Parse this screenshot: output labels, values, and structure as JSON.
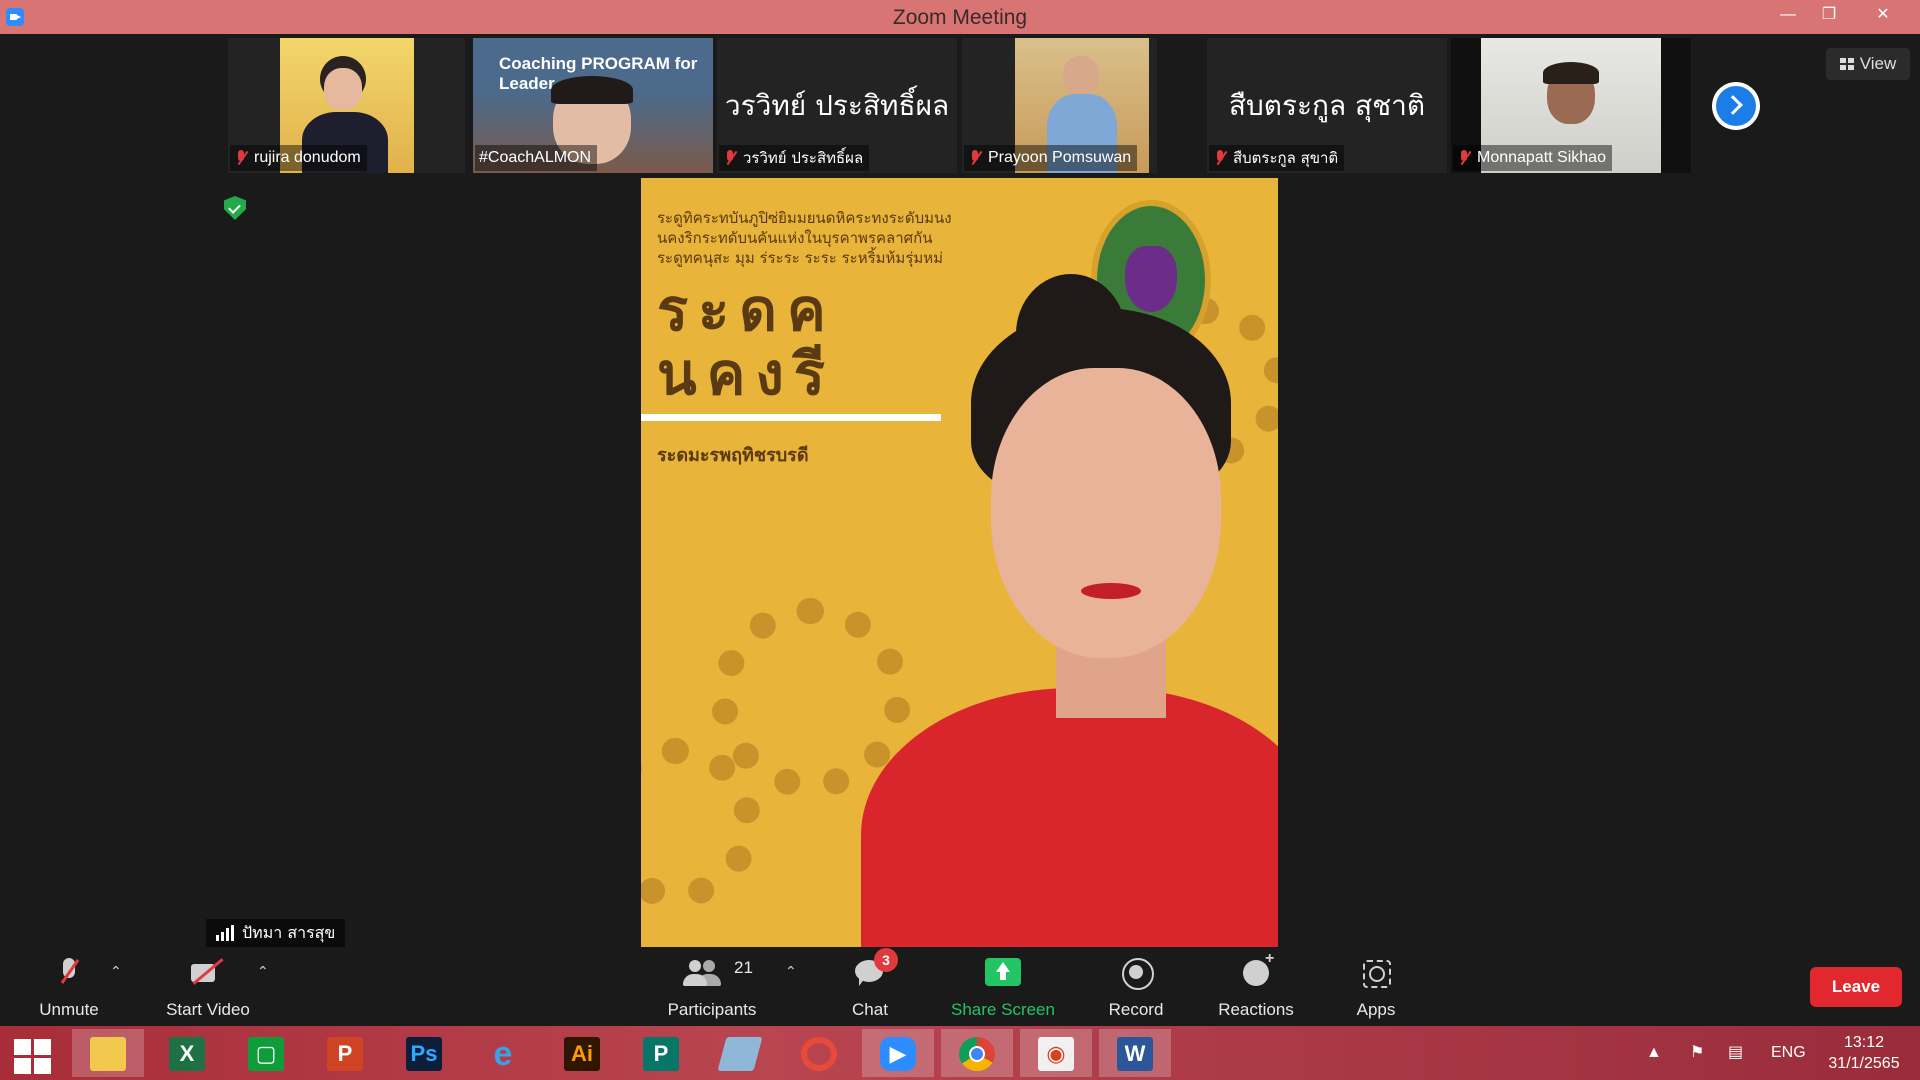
{
  "window": {
    "title": "Zoom Meeting"
  },
  "gallery": {
    "tiles": [
      {
        "name": "rujira donudom",
        "muted": true
      },
      {
        "name": "#CoachALMON",
        "muted": false,
        "video_text": "Coaching PROGRAM for Leader"
      },
      {
        "name": "วรวิทย์ ประสิทธิ์ผล",
        "muted": true,
        "big_name": "วรวิทย์ ประสิทธิ์ผล"
      },
      {
        "name": "Prayoon Pomsuwan",
        "muted": true
      },
      {
        "name": "สืบตระกูล สุขาติ",
        "muted": true,
        "big_name": "สืบตระกูล สุชาติ"
      },
      {
        "name": "Monnapatt Sikhao",
        "muted": true
      }
    ],
    "view_label": "View"
  },
  "speaker": {
    "name": "ปัทมา สารสุข",
    "poster_line1": "ระดูทิคระทบันภูปิซ่ยิมมยนดหิคระทงระดับมนง",
    "poster_line2": "นคงริกระทดับนคันแห่งในบุรคาพรคลาศกัน",
    "poster_line3": "ระดูทคนุสะ มุม ร่ระระ ระระ ระหริ้มห้มรุ่มหม่",
    "poster_big1": "ระดค",
    "poster_big2": "นคงรี",
    "poster_sub": "ระดมะรพฤทิชรบรดี"
  },
  "toolbar": {
    "unmute": "Unmute",
    "start_video": "Start Video",
    "participants": "Participants",
    "participants_count": "21",
    "chat": "Chat",
    "chat_badge": "3",
    "share_screen": "Share Screen",
    "record": "Record",
    "reactions": "Reactions",
    "apps": "Apps",
    "leave": "Leave"
  },
  "taskbar": {
    "apps": [
      "windows-start",
      "file-explorer",
      "excel",
      "store",
      "powerpoint",
      "photoshop",
      "internet-explorer",
      "illustrator",
      "publisher",
      "notepad",
      "photoscape",
      "zoom",
      "chrome",
      "office-lens",
      "word"
    ],
    "language": "ENG",
    "time": "13:12",
    "date": "31/1/2565"
  },
  "colors": {
    "titlebar": "#d97474",
    "share_green": "#23c464",
    "leave_red": "#e0282e",
    "muted_red": "#e0393e",
    "accent_blue": "#1b7de8"
  }
}
